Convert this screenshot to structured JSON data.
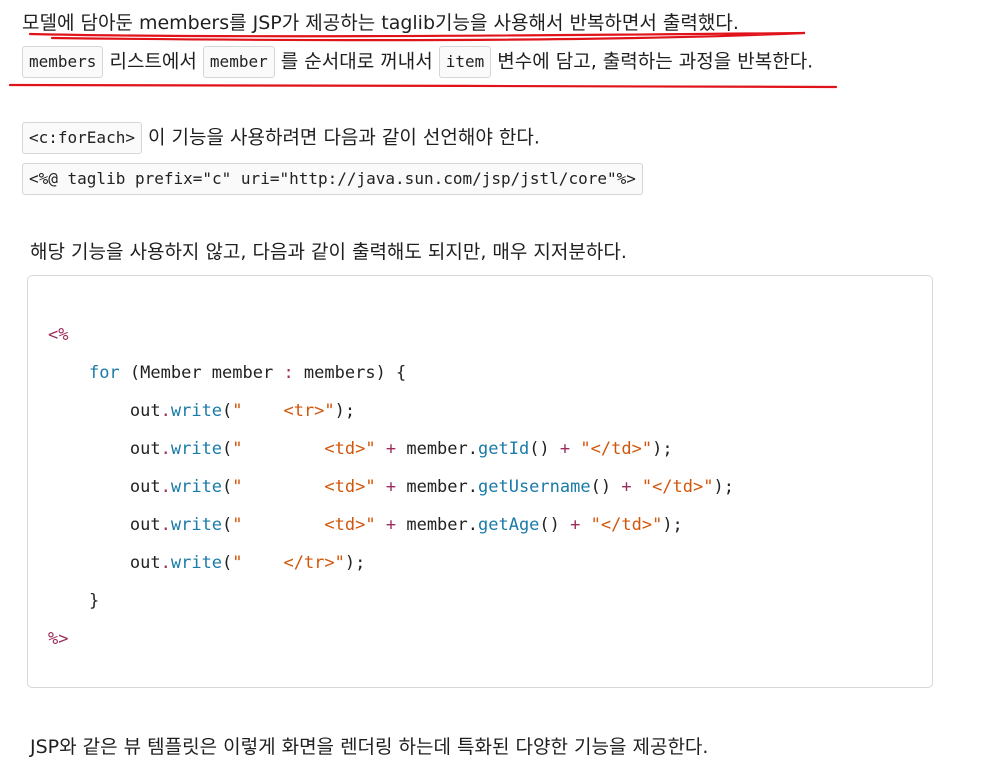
{
  "para1": {
    "line1": "모델에 담아둔 members를 JSP가 제공하는 taglib기능을 사용해서 반복하면서 출력했다.",
    "chip_members": "members",
    "t_after_members": " 리스트에서 ",
    "chip_member": "member",
    "t_after_member": " 를 순서대로 꺼내서 ",
    "chip_item": "item",
    "t_after_item": " 변수에 담고, 출력하는 과정을 반복한다."
  },
  "para2": {
    "chip_foreach": "<c:forEach>",
    "t_after_foreach": " 이 기능을 사용하려면 다음과 같이 선언해야 한다.",
    "taglib_decl": "<%@ taglib prefix=\"c\" uri=\"http://java.sun.com/jsp/jstl/core\"%>"
  },
  "para3": "해당 기능을 사용하지 않고, 다음과 같이 출력해도 되지만, 매우 지저분하다.",
  "code": {
    "open": "<%",
    "for_kw": "for",
    "for_rest_a": " (Member member ",
    "for_colon": ":",
    "for_rest_b": " members) {",
    "out": "out",
    "dot": ".",
    "write": "write",
    "paren_open": "(",
    "l1_str": "\"    <tr>\"",
    "l2_str_a": "\"        <td>\"",
    "plus": "+",
    "member_dot": "member.",
    "getId": "getId",
    "getUsername": "getUsername",
    "getAge": "getAge",
    "call": "()",
    "l2_str_b": "\"</td>\"",
    "end": ");",
    "l5_str": "\"    </tr>\"",
    "brace": "}",
    "close": "%>"
  },
  "para4": "JSP와 같은 뷰 템플릿은 이렇게 화면을 렌더링 하는데 특화된 다양한 기능을 제공한다.",
  "colors": {
    "annotation_red": "#e0131a",
    "keyword": "#1a7aa8",
    "string": "#d2560a",
    "tag": "#9b2c5b"
  }
}
